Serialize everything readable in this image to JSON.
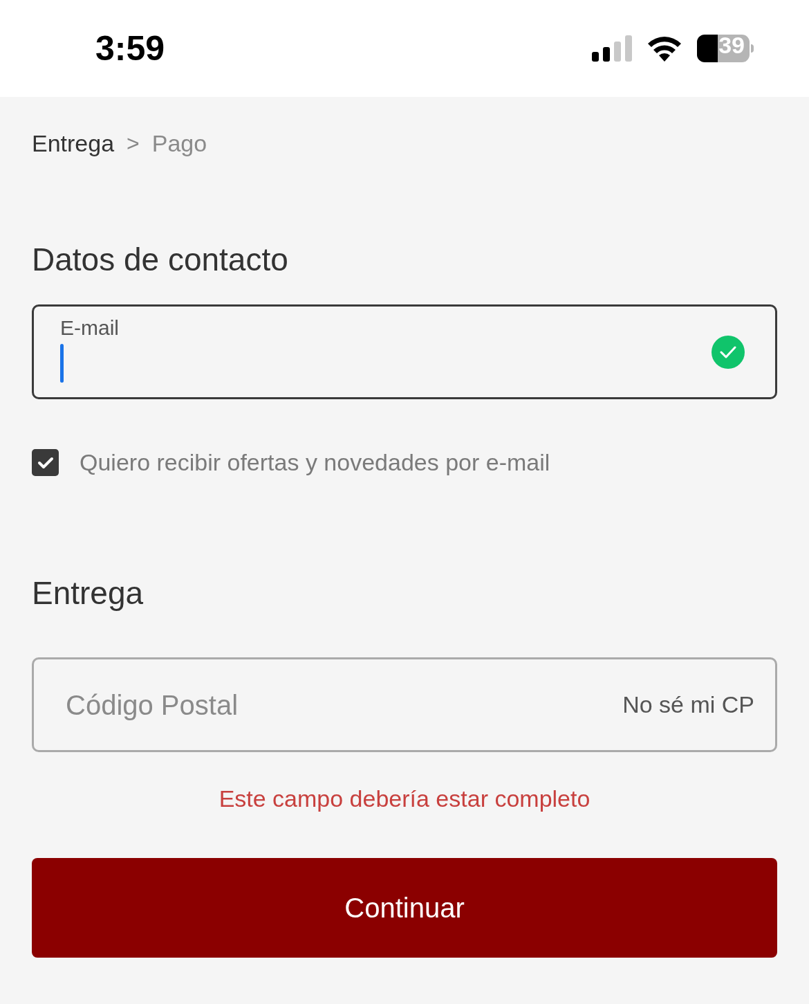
{
  "status_bar": {
    "time": "3:59",
    "battery": "39"
  },
  "breadcrumb": [
    {
      "label": "Entrega",
      "selected": true
    },
    {
      "label": ">",
      "kind": "separator"
    },
    {
      "label": "Pago",
      "selected": false
    }
  ],
  "contact": {
    "heading": "Datos de contacto",
    "email": {
      "label": "E-mail",
      "focused": true,
      "valid": true
    },
    "newsletter": {
      "label": "Quiero recibir ofertas y novedades por e-mail",
      "checked": true
    }
  },
  "delivery": {
    "heading": "Entrega",
    "postal_code": {
      "placeholder": "Código Postal",
      "link": "No sé mi CP"
    },
    "error": "Este campo debería estar completo"
  },
  "button": "Continuar"
}
